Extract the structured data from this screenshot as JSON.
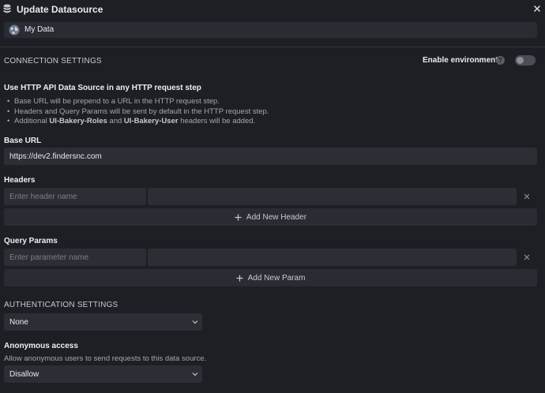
{
  "header": {
    "title": "Update Datasource"
  },
  "datasource": {
    "name": "My Data"
  },
  "connection": {
    "section_title": "CONNECTION SETTINGS",
    "env_label": "Enable environments",
    "env_enabled": false,
    "help_glyph": "?",
    "http_heading": "Use HTTP API Data Source in any HTTP request step",
    "bullets": {
      "b1": "Base URL will be prepend to a URL in the HTTP request step.",
      "b2": "Headers and Query Params will be sent by default in the HTTP request step.",
      "b3_pre": "Additional ",
      "b3_role": "UI-Bakery-Roles",
      "b3_mid": " and ",
      "b3_user": "UI-Bakery-User",
      "b3_post": " headers will be added."
    },
    "base_url_label": "Base URL",
    "base_url_value": "https://dev2.findersnc.com",
    "headers_label": "Headers",
    "header_name_placeholder": "Enter header name",
    "add_header_label": "Add New Header",
    "query_params_label": "Query Params",
    "param_name_placeholder": "Enter parameter name",
    "add_param_label": "Add New Param"
  },
  "authentication": {
    "section_title": "AUTHENTICATION SETTINGS",
    "selected": "None"
  },
  "anonymous": {
    "label": "Anonymous access",
    "description": "Allow anonymous users to send requests to this data source.",
    "selected": "Disallow"
  },
  "colors": {
    "background": "#1e1f24",
    "input": "#2c2e36",
    "text": "#e8eaf0",
    "muted": "#a4a7b0"
  }
}
